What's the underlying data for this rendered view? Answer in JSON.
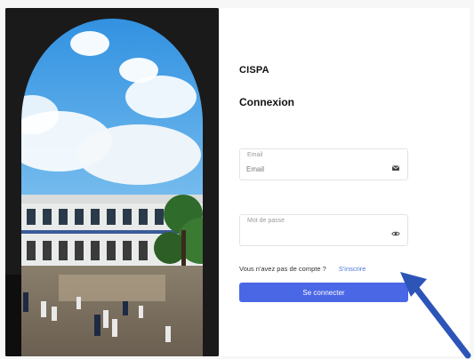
{
  "brand": "CISPA",
  "form": {
    "title": "Connexion",
    "email": {
      "label": "Email",
      "placeholder": "Email",
      "icon": "envelope-icon"
    },
    "password": {
      "label": "Mot de passe",
      "placeholder": "",
      "icon": "eye-icon"
    },
    "signup_prompt": "Vous n'avez pas de compte ?",
    "signup_link": "S'inscrire",
    "submit_label": "Se connecter"
  },
  "photo": {
    "subject": "campus-building-arch-photo"
  },
  "annotation": {
    "icon": "arrow-icon",
    "color": "#2d55b8"
  },
  "colors": {
    "primary_button": "#4a67e6",
    "link": "#4a78d8"
  }
}
